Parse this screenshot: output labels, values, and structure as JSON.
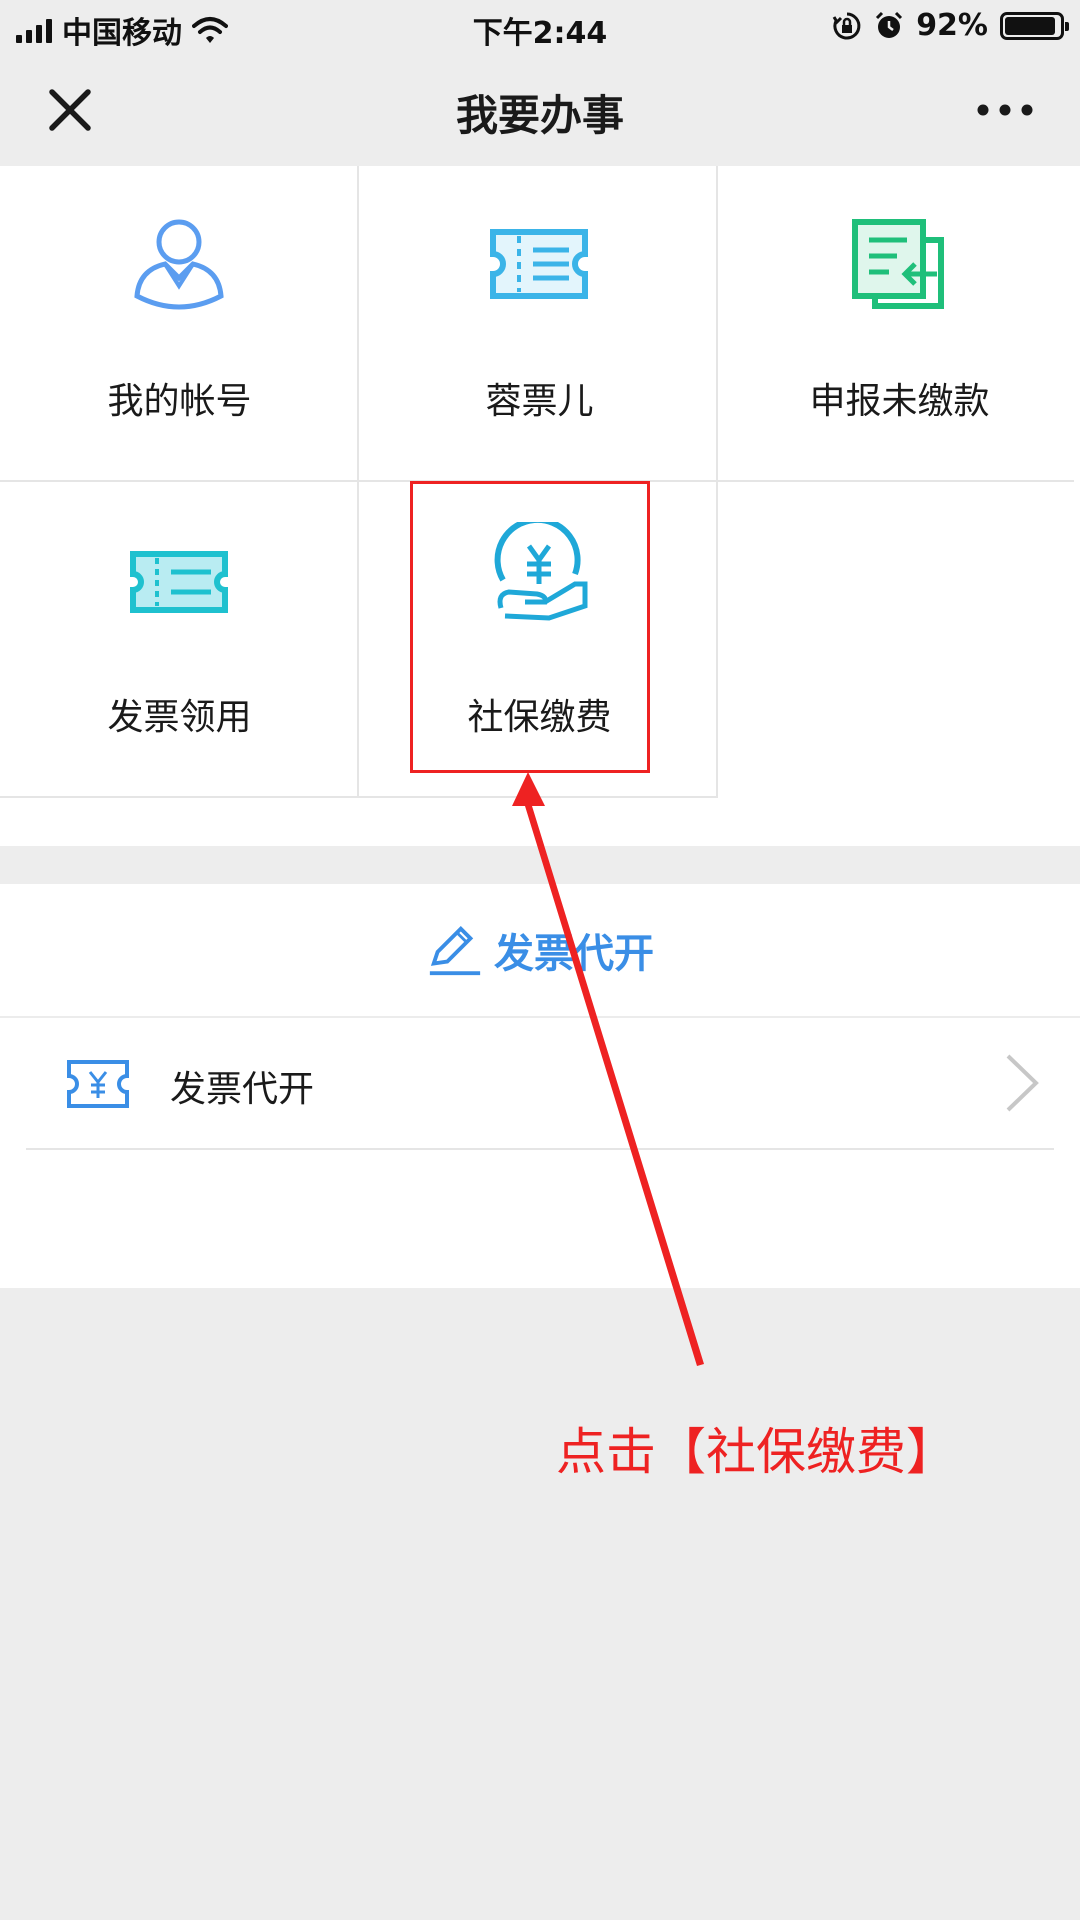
{
  "status_bar": {
    "carrier": "中国移动",
    "time": "下午2:44",
    "battery": "92%",
    "battery_level": 0.92
  },
  "nav": {
    "title": "我要办事",
    "close_icon": "close-icon",
    "more_icon": "more-icon"
  },
  "grid": {
    "items": [
      {
        "label": "我的帐号",
        "icon": "user-icon",
        "color": "#5b9df0"
      },
      {
        "label": "蓉票儿",
        "icon": "ticket-icon",
        "color": "#3bb4e8"
      },
      {
        "label": "申报未缴款",
        "icon": "document-return-icon",
        "color": "#1fbf7a"
      },
      {
        "label": "发票领用",
        "icon": "invoice-ticket-icon",
        "color": "#1fc1cf"
      },
      {
        "label": "社保缴费",
        "icon": "yuan-hand-icon",
        "color": "#1fa8d8"
      }
    ]
  },
  "invoice_section": {
    "title": "发票代开",
    "title_icon": "pen-icon",
    "items": [
      {
        "label": "发票代开",
        "icon": "yuan-ticket-icon"
      }
    ]
  },
  "annotation": {
    "text": "点击【社保缴费】",
    "color": "#ee2222"
  },
  "colors": {
    "background": "#ededed",
    "accent_blue": "#3a8ee6"
  }
}
